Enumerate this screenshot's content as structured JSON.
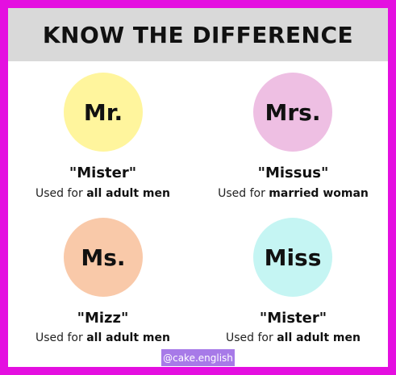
{
  "header": {
    "title": "KNOW THE DIFFERENCE"
  },
  "items": [
    {
      "abbr": "Mr.",
      "quote": "\"Mister\"",
      "desc_prefix": "Used for ",
      "desc_bold": "all adult men",
      "circle_color": "#fff59d"
    },
    {
      "abbr": "Mrs.",
      "quote": "\"Missus\"",
      "desc_prefix": "Used for ",
      "desc_bold": "married woman",
      "circle_color": "#eebfe3"
    },
    {
      "abbr": "Ms.",
      "quote": "\"Mizz\"",
      "desc_prefix": "Used for ",
      "desc_bold": "all adult men",
      "circle_color": "#f9c9a9"
    },
    {
      "abbr": "Miss",
      "quote": "\"Mister\"",
      "desc_prefix": "Used for ",
      "desc_bold": "all adult men",
      "circle_color": "#c5f5f3"
    }
  ],
  "watermark": "@cake.english",
  "colors": {
    "border": "#e40fe0",
    "header_bg": "#d9d9d9",
    "watermark_bg": "#a77ae8"
  }
}
